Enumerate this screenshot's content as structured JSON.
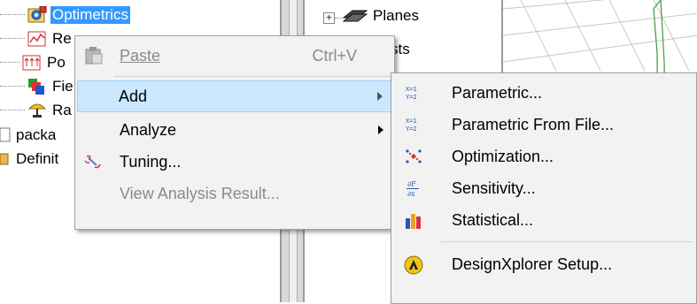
{
  "tree": {
    "items": [
      {
        "label": "Optimetrics",
        "icon": "optimetrics-icon",
        "selected": true
      },
      {
        "label": "Re",
        "icon": "results-icon"
      },
      {
        "label": "Po",
        "icon": "port-field-icon"
      },
      {
        "label": "Fie",
        "icon": "field-overlays-icon"
      },
      {
        "label": "Ra",
        "icon": "radiation-icon"
      },
      {
        "label": "packa",
        "icon": "document-icon"
      },
      {
        "label": "Definit",
        "icon": "definitions-icon"
      }
    ]
  },
  "mid_tree": {
    "expander": "+",
    "items": [
      {
        "label": "Planes",
        "icon": "planes-icon"
      },
      {
        "label": "sts"
      }
    ]
  },
  "context_menu": {
    "items": [
      {
        "label": "Paste",
        "shortcut": "Ctrl+V",
        "icon": "clipboard-icon",
        "disabled": true
      },
      {
        "label": "Add",
        "has_submenu": true,
        "highlighted": true
      },
      {
        "label": "Analyze",
        "has_submenu": true
      },
      {
        "label": "Tuning...",
        "icon": "tuning-icon"
      },
      {
        "label": "View Analysis Result...",
        "disabled": true
      }
    ]
  },
  "submenu": {
    "items": [
      {
        "label": "Parametric...",
        "icon": "parametric-icon",
        "icon_text": "X=1\nY=2"
      },
      {
        "label": "Parametric From File...",
        "icon": "parametric-file-icon",
        "icon_text": "X=1\nY=2"
      },
      {
        "label": "Optimization...",
        "icon": "optimization-icon"
      },
      {
        "label": "Sensitivity...",
        "icon": "sensitivity-icon",
        "icon_text": "∂F\n∂x"
      },
      {
        "label": "Statistical...",
        "icon": "statistical-icon"
      },
      {
        "label": "DesignXplorer Setup...",
        "icon": "designxplorer-icon"
      }
    ]
  },
  "colors": {
    "selection": "#3399ff",
    "menu_bg": "#f2f2f2",
    "highlight": "#cce8ff",
    "disabled_text": "#8a8a8a"
  }
}
